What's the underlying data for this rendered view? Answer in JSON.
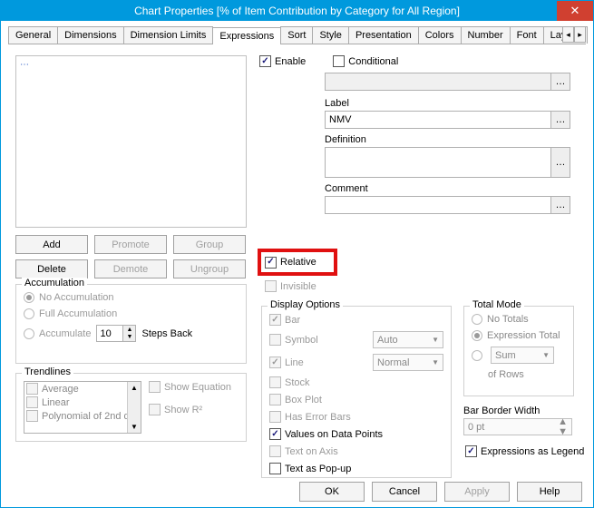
{
  "window": {
    "title": "Chart Properties [% of Item Contribution by Category for All Region]"
  },
  "tabs": [
    "General",
    "Dimensions",
    "Dimension Limits",
    "Expressions",
    "Sort",
    "Style",
    "Presentation",
    "Colors",
    "Number",
    "Font",
    "Layout"
  ],
  "active_tab": "Expressions",
  "right": {
    "enable": "Enable",
    "conditional": "Conditional",
    "label_label": "Label",
    "label_value": "NMV",
    "definition_label": "Definition",
    "definition_value": "",
    "comment_label": "Comment",
    "comment_value": ""
  },
  "buttons": {
    "add": "Add",
    "promote": "Promote",
    "group": "Group",
    "delete": "Delete",
    "demote": "Demote",
    "ungroup": "Ungroup"
  },
  "accum": {
    "title": "Accumulation",
    "none": "No Accumulation",
    "full": "Full Accumulation",
    "n": "Accumulate",
    "n_value": "10",
    "steps": "Steps Back"
  },
  "trend": {
    "title": "Trendlines",
    "items": [
      "Average",
      "Linear",
      "Polynomial of 2nd d"
    ],
    "show_equation": "Show Equation",
    "show_r2": "Show R²"
  },
  "relative": "Relative",
  "invisible": "Invisible",
  "display": {
    "title": "Display Options",
    "bar": "Bar",
    "symbol": "Symbol",
    "symbol_val": "Auto",
    "line": "Line",
    "line_val": "Normal",
    "stock": "Stock",
    "boxplot": "Box Plot",
    "errorbars": "Has Error Bars",
    "values": "Values on Data Points",
    "textaxis": "Text on Axis",
    "popup": "Text as Pop-up"
  },
  "total": {
    "title": "Total Mode",
    "none": "No Totals",
    "expr": "Expression Total",
    "sum": "Sum",
    "rows": "of Rows"
  },
  "barborder": {
    "label": "Bar Border Width",
    "value": "0 pt"
  },
  "legend": "Expressions as Legend",
  "footer": {
    "ok": "OK",
    "cancel": "Cancel",
    "apply": "Apply",
    "help": "Help"
  }
}
